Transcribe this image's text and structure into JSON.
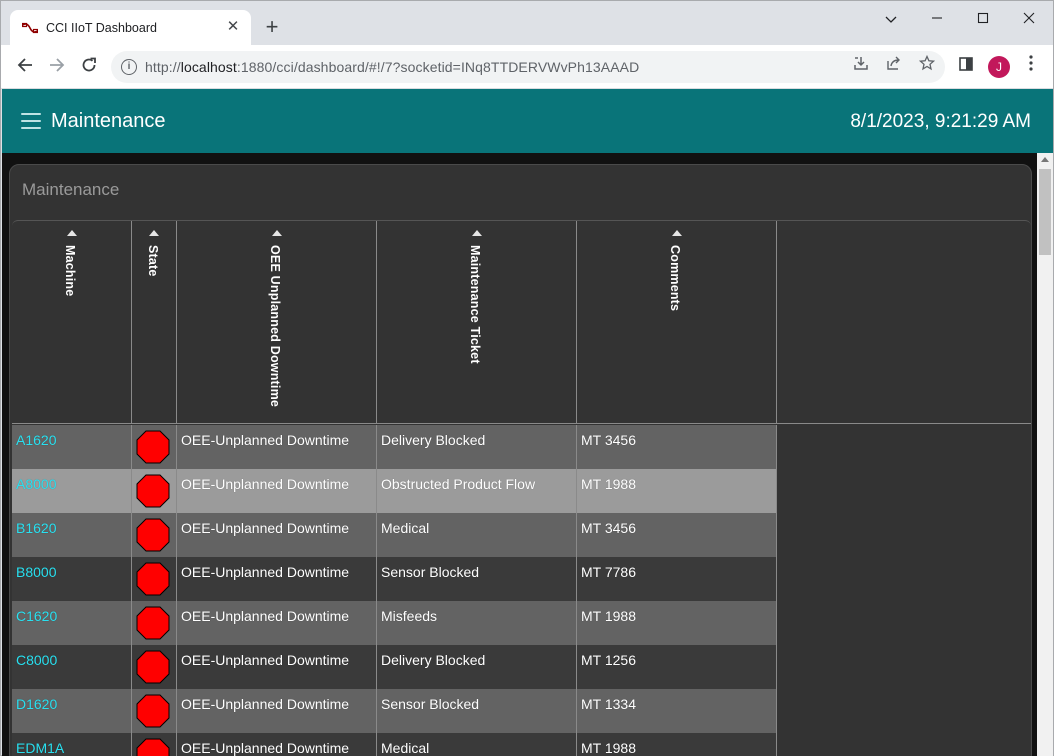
{
  "browser": {
    "tab_title": "CCI IIoT Dashboard",
    "tab_close": "✕",
    "new_tab": "+",
    "url_host": "localhost",
    "url_prefix": "http://",
    "url_rest": ":1880/cci/dashboard/#!/7?socketid=INq8TTDERVWvPh13AAAD",
    "profile_initial": "J",
    "icons": [
      "back-arrow-icon",
      "forward-arrow-icon",
      "reload-icon",
      "info-icon",
      "install-icon",
      "share-icon",
      "bookmark-star-icon",
      "side-panel-icon",
      "kebab-menu-icon",
      "chevron-down-icon",
      "minimize-icon",
      "maximize-icon",
      "close-icon"
    ]
  },
  "header": {
    "title": "Maintenance",
    "datetime": "8/1/2023, 9:21:29 AM"
  },
  "card": {
    "title": "Maintenance"
  },
  "table": {
    "columns": [
      "Machine",
      "State",
      "OEE Unplanned Downtime",
      "Maintenance Ticket",
      "Comments"
    ],
    "rows": [
      {
        "machine": "A1620",
        "state": "stop",
        "oee": "OEE-Unplanned Downtime",
        "ticket": "Delivery Blocked",
        "comments": "MT 3456"
      },
      {
        "machine": "A8000",
        "state": "stop",
        "oee": "OEE-Unplanned Downtime",
        "ticket": "Obstructed Product Flow",
        "comments": "MT 1988"
      },
      {
        "machine": "B1620",
        "state": "stop",
        "oee": "OEE-Unplanned Downtime",
        "ticket": "Medical",
        "comments": "MT 3456"
      },
      {
        "machine": "B8000",
        "state": "stop",
        "oee": "OEE-Unplanned Downtime",
        "ticket": "Sensor Blocked",
        "comments": "MT 7786"
      },
      {
        "machine": "C1620",
        "state": "stop",
        "oee": "OEE-Unplanned Downtime",
        "ticket": "Misfeeds",
        "comments": "MT 1988"
      },
      {
        "machine": "C8000",
        "state": "stop",
        "oee": "OEE-Unplanned Downtime",
        "ticket": "Delivery Blocked",
        "comments": "MT 1256"
      },
      {
        "machine": "D1620",
        "state": "stop",
        "oee": "OEE-Unplanned Downtime",
        "ticket": "Sensor Blocked",
        "comments": "MT 1334"
      },
      {
        "machine": "EDM1A",
        "state": "stop",
        "oee": "OEE-Unplanned Downtime",
        "ticket": "Medical",
        "comments": "MT 1988"
      }
    ]
  },
  "colors": {
    "appbar": "#097479",
    "machine_link": "#29e0f0",
    "state_stop": "#ff0000"
  }
}
